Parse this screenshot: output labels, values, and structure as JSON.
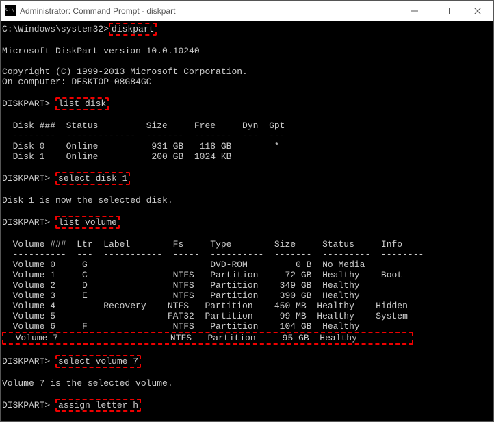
{
  "titlebar": {
    "title": "Administrator: Command Prompt - diskpart"
  },
  "highlight_color": "#e00000",
  "prompts": {
    "sys": "C:\\Windows\\system32>",
    "dp": "DISKPART> "
  },
  "cmds": {
    "diskpart": "diskpart",
    "listdisk": "list disk",
    "selectdisk": "select disk 1",
    "listvol": "list volume",
    "selectvol": "select volume 7",
    "assign": "assign letter=h"
  },
  "text": {
    "version": "Microsoft DiskPart version 10.0.10240",
    "copyright": "Copyright (C) 1999-2013 Microsoft Corporation.",
    "oncomputer": "On computer: DESKTOP-08G84GC",
    "diskheader": "  Disk ###  Status         Size     Free     Dyn  Gpt",
    "diskdivider": "  --------  -------------  -------  -------  ---  ---",
    "selected_disk_msg": "Disk 1 is now the selected disk.",
    "volheader": "  Volume ###  Ltr  Label        Fs     Type        Size     Status     Info",
    "voldivider": "  ----------  ---  -----------  -----  ----------  -------  ---------  --------",
    "selected_vol_msg": "Volume 7 is the selected volume."
  },
  "disks": [
    {
      "row": "  Disk 0    Online          931 GB   118 GB        *"
    },
    {
      "row": "  Disk 1    Online          200 GB  1024 KB"
    }
  ],
  "volumes": [
    {
      "row": "  Volume 0     G                       DVD-ROM         0 B  No Media"
    },
    {
      "row": "  Volume 1     C                NTFS   Partition     72 GB  Healthy    Boot"
    },
    {
      "row": "  Volume 2     D                NTFS   Partition    349 GB  Healthy"
    },
    {
      "row": "  Volume 3     E                NTFS   Partition    390 GB  Healthy"
    },
    {
      "row": "  Volume 4         Recovery    NTFS   Partition    450 MB  Healthy    Hidden"
    },
    {
      "row": "  Volume 5                     FAT32  Partition     99 MB  Healthy    System"
    },
    {
      "row": "  Volume 6     F                NTFS   Partition    104 GB  Healthy"
    }
  ],
  "volume7": {
    "row": "  Volume 7                     NTFS   Partition     95 GB  Healthy          "
  }
}
